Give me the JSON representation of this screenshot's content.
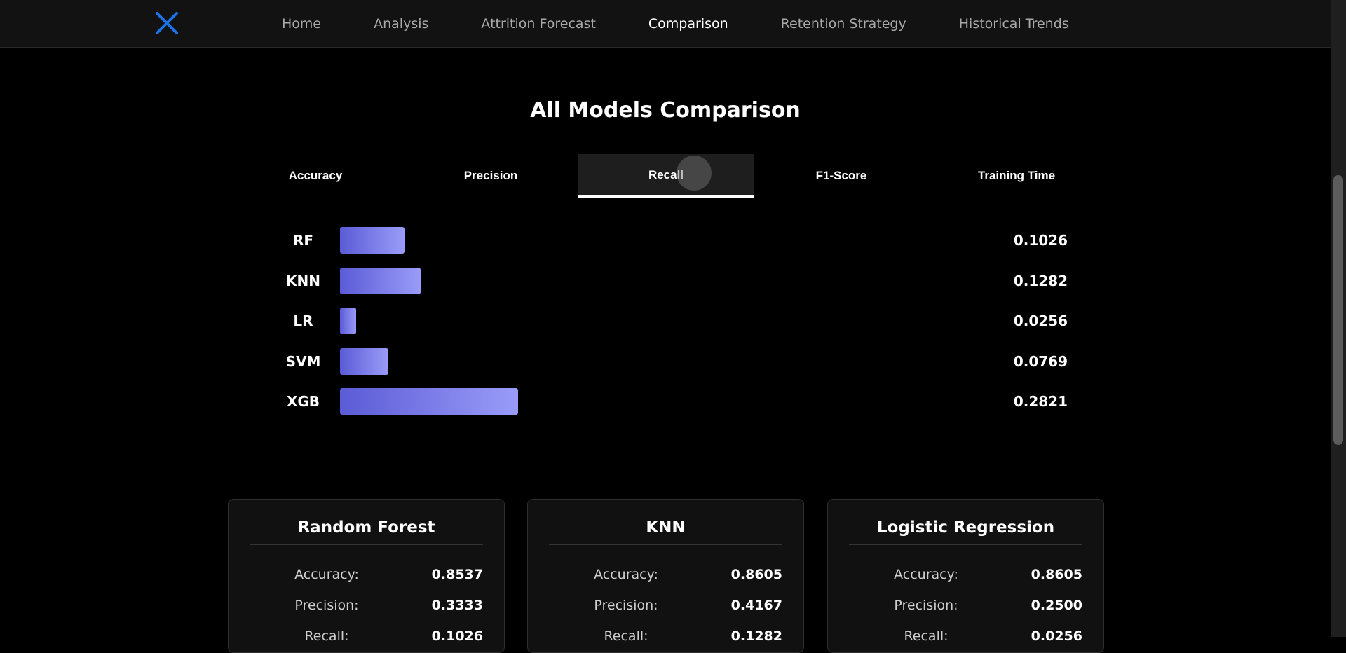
{
  "nav": {
    "logo_icon": "close-x-logo",
    "links": [
      "Home",
      "Analysis",
      "Attrition Forecast",
      "Comparison",
      "Retention Strategy",
      "Historical Trends"
    ],
    "active": "Comparison"
  },
  "page": {
    "title": "All Models Comparison"
  },
  "tabs": {
    "items": [
      "Accuracy",
      "Precision",
      "Recall",
      "F1-Score",
      "Training Time"
    ],
    "active": "Recall"
  },
  "chart_data": {
    "type": "bar",
    "orientation": "horizontal",
    "categories": [
      "RF",
      "KNN",
      "LR",
      "SVM",
      "XGB"
    ],
    "values": [
      0.1026,
      0.1282,
      0.0256,
      0.0769,
      0.2821
    ],
    "value_labels": [
      "0.1026",
      "0.1282",
      "0.0256",
      "0.0769",
      "0.2821"
    ],
    "xlim": [
      0,
      1
    ],
    "colors": {
      "bar_start": "#5b5bd6",
      "bar_end": "#9a9cf8"
    }
  },
  "cards": [
    {
      "title": "Random Forest",
      "metrics": [
        {
          "label": "Accuracy:",
          "value": "0.8537"
        },
        {
          "label": "Precision:",
          "value": "0.3333"
        },
        {
          "label": "Recall:",
          "value": "0.1026"
        }
      ]
    },
    {
      "title": "KNN",
      "metrics": [
        {
          "label": "Accuracy:",
          "value": "0.8605"
        },
        {
          "label": "Precision:",
          "value": "0.4167"
        },
        {
          "label": "Recall:",
          "value": "0.1282"
        }
      ]
    },
    {
      "title": "Logistic Regression",
      "metrics": [
        {
          "label": "Accuracy:",
          "value": "0.8605"
        },
        {
          "label": "Precision:",
          "value": "0.2500"
        },
        {
          "label": "Recall:",
          "value": "0.0256"
        }
      ]
    }
  ],
  "colors": {
    "accent_logo": "#1a73e8",
    "background": "#000000",
    "navbar": "#121212"
  }
}
